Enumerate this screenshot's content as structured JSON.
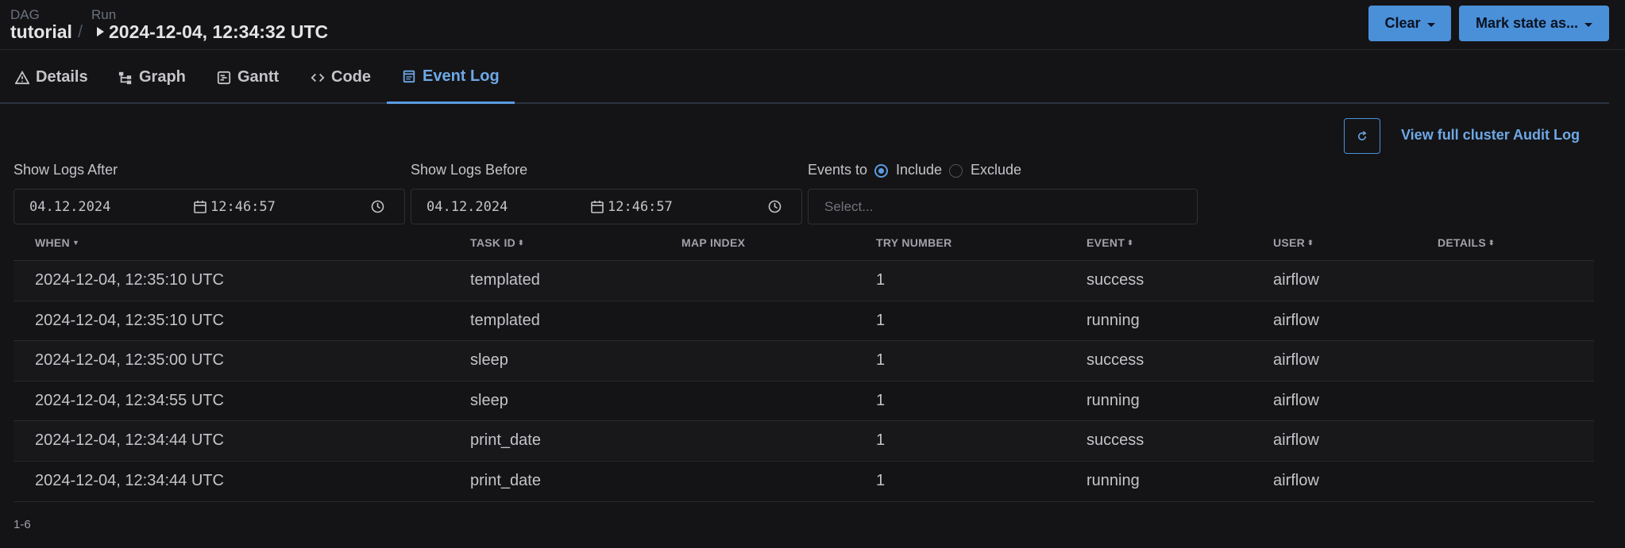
{
  "breadcrumb": {
    "dag_label": "DAG",
    "dag_name": "tutorial",
    "separator": "/",
    "run_label": "Run",
    "run_id": "2024-12-04, 12:34:32 UTC"
  },
  "header_buttons": {
    "clear": "Clear",
    "mark_state": "Mark state as..."
  },
  "tabs": [
    {
      "label": "Details",
      "icon": "warning-triangle-icon"
    },
    {
      "label": "Graph",
      "icon": "graph-icon"
    },
    {
      "label": "Gantt",
      "icon": "gantt-icon"
    },
    {
      "label": "Code",
      "icon": "code-icon"
    },
    {
      "label": "Event Log",
      "icon": "calendar-icon",
      "active": true
    }
  ],
  "toolbar": {
    "refresh_icon": "refresh-icon",
    "audit_link": "View full cluster Audit Log"
  },
  "filters": {
    "after_label": "Show Logs After",
    "after_date": "04.12.2024",
    "after_time": "12:46:57",
    "before_label": "Show Logs Before",
    "before_date": "04.12.2024",
    "before_time": "12:46:57",
    "events_to_label": "Events to",
    "include_label": "Include",
    "exclude_label": "Exclude",
    "include_selected": true,
    "select_placeholder": "Select..."
  },
  "table": {
    "columns": [
      "WHEN",
      "TASK ID",
      "MAP INDEX",
      "TRY NUMBER",
      "EVENT",
      "USER",
      "DETAILS"
    ],
    "rows": [
      {
        "when": "2024-12-04, 12:35:10 UTC",
        "task_id": "templated",
        "map_index": "",
        "try_number": "1",
        "event": "success",
        "user": "airflow",
        "details": ""
      },
      {
        "when": "2024-12-04, 12:35:10 UTC",
        "task_id": "templated",
        "map_index": "",
        "try_number": "1",
        "event": "running",
        "user": "airflow",
        "details": ""
      },
      {
        "when": "2024-12-04, 12:35:00 UTC",
        "task_id": "sleep",
        "map_index": "",
        "try_number": "1",
        "event": "success",
        "user": "airflow",
        "details": ""
      },
      {
        "when": "2024-12-04, 12:34:55 UTC",
        "task_id": "sleep",
        "map_index": "",
        "try_number": "1",
        "event": "running",
        "user": "airflow",
        "details": ""
      },
      {
        "when": "2024-12-04, 12:34:44 UTC",
        "task_id": "print_date",
        "map_index": "",
        "try_number": "1",
        "event": "success",
        "user": "airflow",
        "details": ""
      },
      {
        "when": "2024-12-04, 12:34:44 UTC",
        "task_id": "print_date",
        "map_index": "",
        "try_number": "1",
        "event": "running",
        "user": "airflow",
        "details": ""
      }
    ]
  },
  "pagination": {
    "range": "1-6"
  },
  "colors": {
    "accent": "#4a90d9",
    "link": "#6ea8e6",
    "background": "#141416"
  }
}
